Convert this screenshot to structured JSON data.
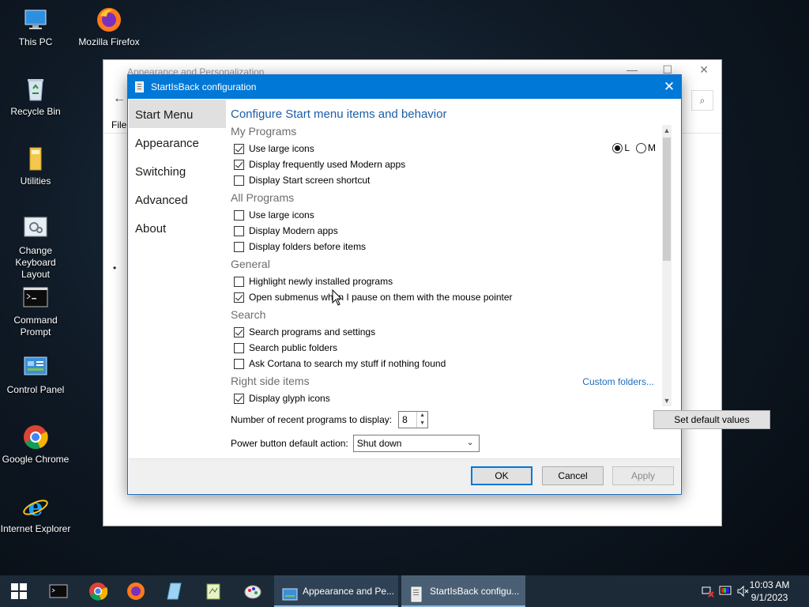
{
  "desktop": {
    "icons": [
      {
        "label": "This PC"
      },
      {
        "label": "Mozilla Firefox"
      },
      {
        "label": "Recycle Bin"
      },
      {
        "label": "Utilities"
      },
      {
        "label": "Change Keyboard Layout"
      },
      {
        "label": "Command Prompt"
      },
      {
        "label": "Control Panel"
      },
      {
        "label": "Google Chrome"
      },
      {
        "label": "Internet Explorer"
      }
    ]
  },
  "bg_window": {
    "title": "Appearance and Personalization",
    "menu_file": "File"
  },
  "dialog": {
    "title": "StartIsBack configuration",
    "close_glyph": "✕",
    "nav": [
      "Start Menu",
      "Appearance",
      "Switching",
      "Advanced",
      "About"
    ],
    "heading": "Configure Start menu items and behavior",
    "sections": {
      "my_programs": "My Programs",
      "all_programs": "All Programs",
      "general": "General",
      "search": "Search",
      "right_side": "Right side items"
    },
    "options": {
      "mp_large_icons": "Use large icons",
      "mp_modern_apps": "Display frequently used Modern apps",
      "mp_start_screen": "Display Start screen shortcut",
      "ap_large_icons": "Use large icons",
      "ap_modern_apps": "Display Modern apps",
      "ap_folders_first": "Display folders before items",
      "gen_highlight": "Highlight newly installed programs",
      "gen_open_submenus": "Open submenus when I pause on them with the mouse pointer",
      "srch_programs": "Search programs and settings",
      "srch_public": "Search public folders",
      "srch_cortana": "Ask Cortana to search my stuff if nothing found",
      "rs_glyph": "Display glyph icons"
    },
    "radio": {
      "l": "L",
      "m": "M"
    },
    "custom_folders": "Custom folders...",
    "recent_label": "Number of recent programs to display:",
    "recent_value": "8",
    "set_default": "Set default values",
    "power_label": "Power button default action:",
    "power_value": "Shut down",
    "buttons": {
      "ok": "OK",
      "cancel": "Cancel",
      "apply": "Apply"
    }
  },
  "taskbar": {
    "tasks": [
      {
        "label": "Appearance and Pe..."
      },
      {
        "label": "StartIsBack configu..."
      }
    ],
    "clock_time": "10:03 AM",
    "clock_date": "9/1/2023"
  }
}
